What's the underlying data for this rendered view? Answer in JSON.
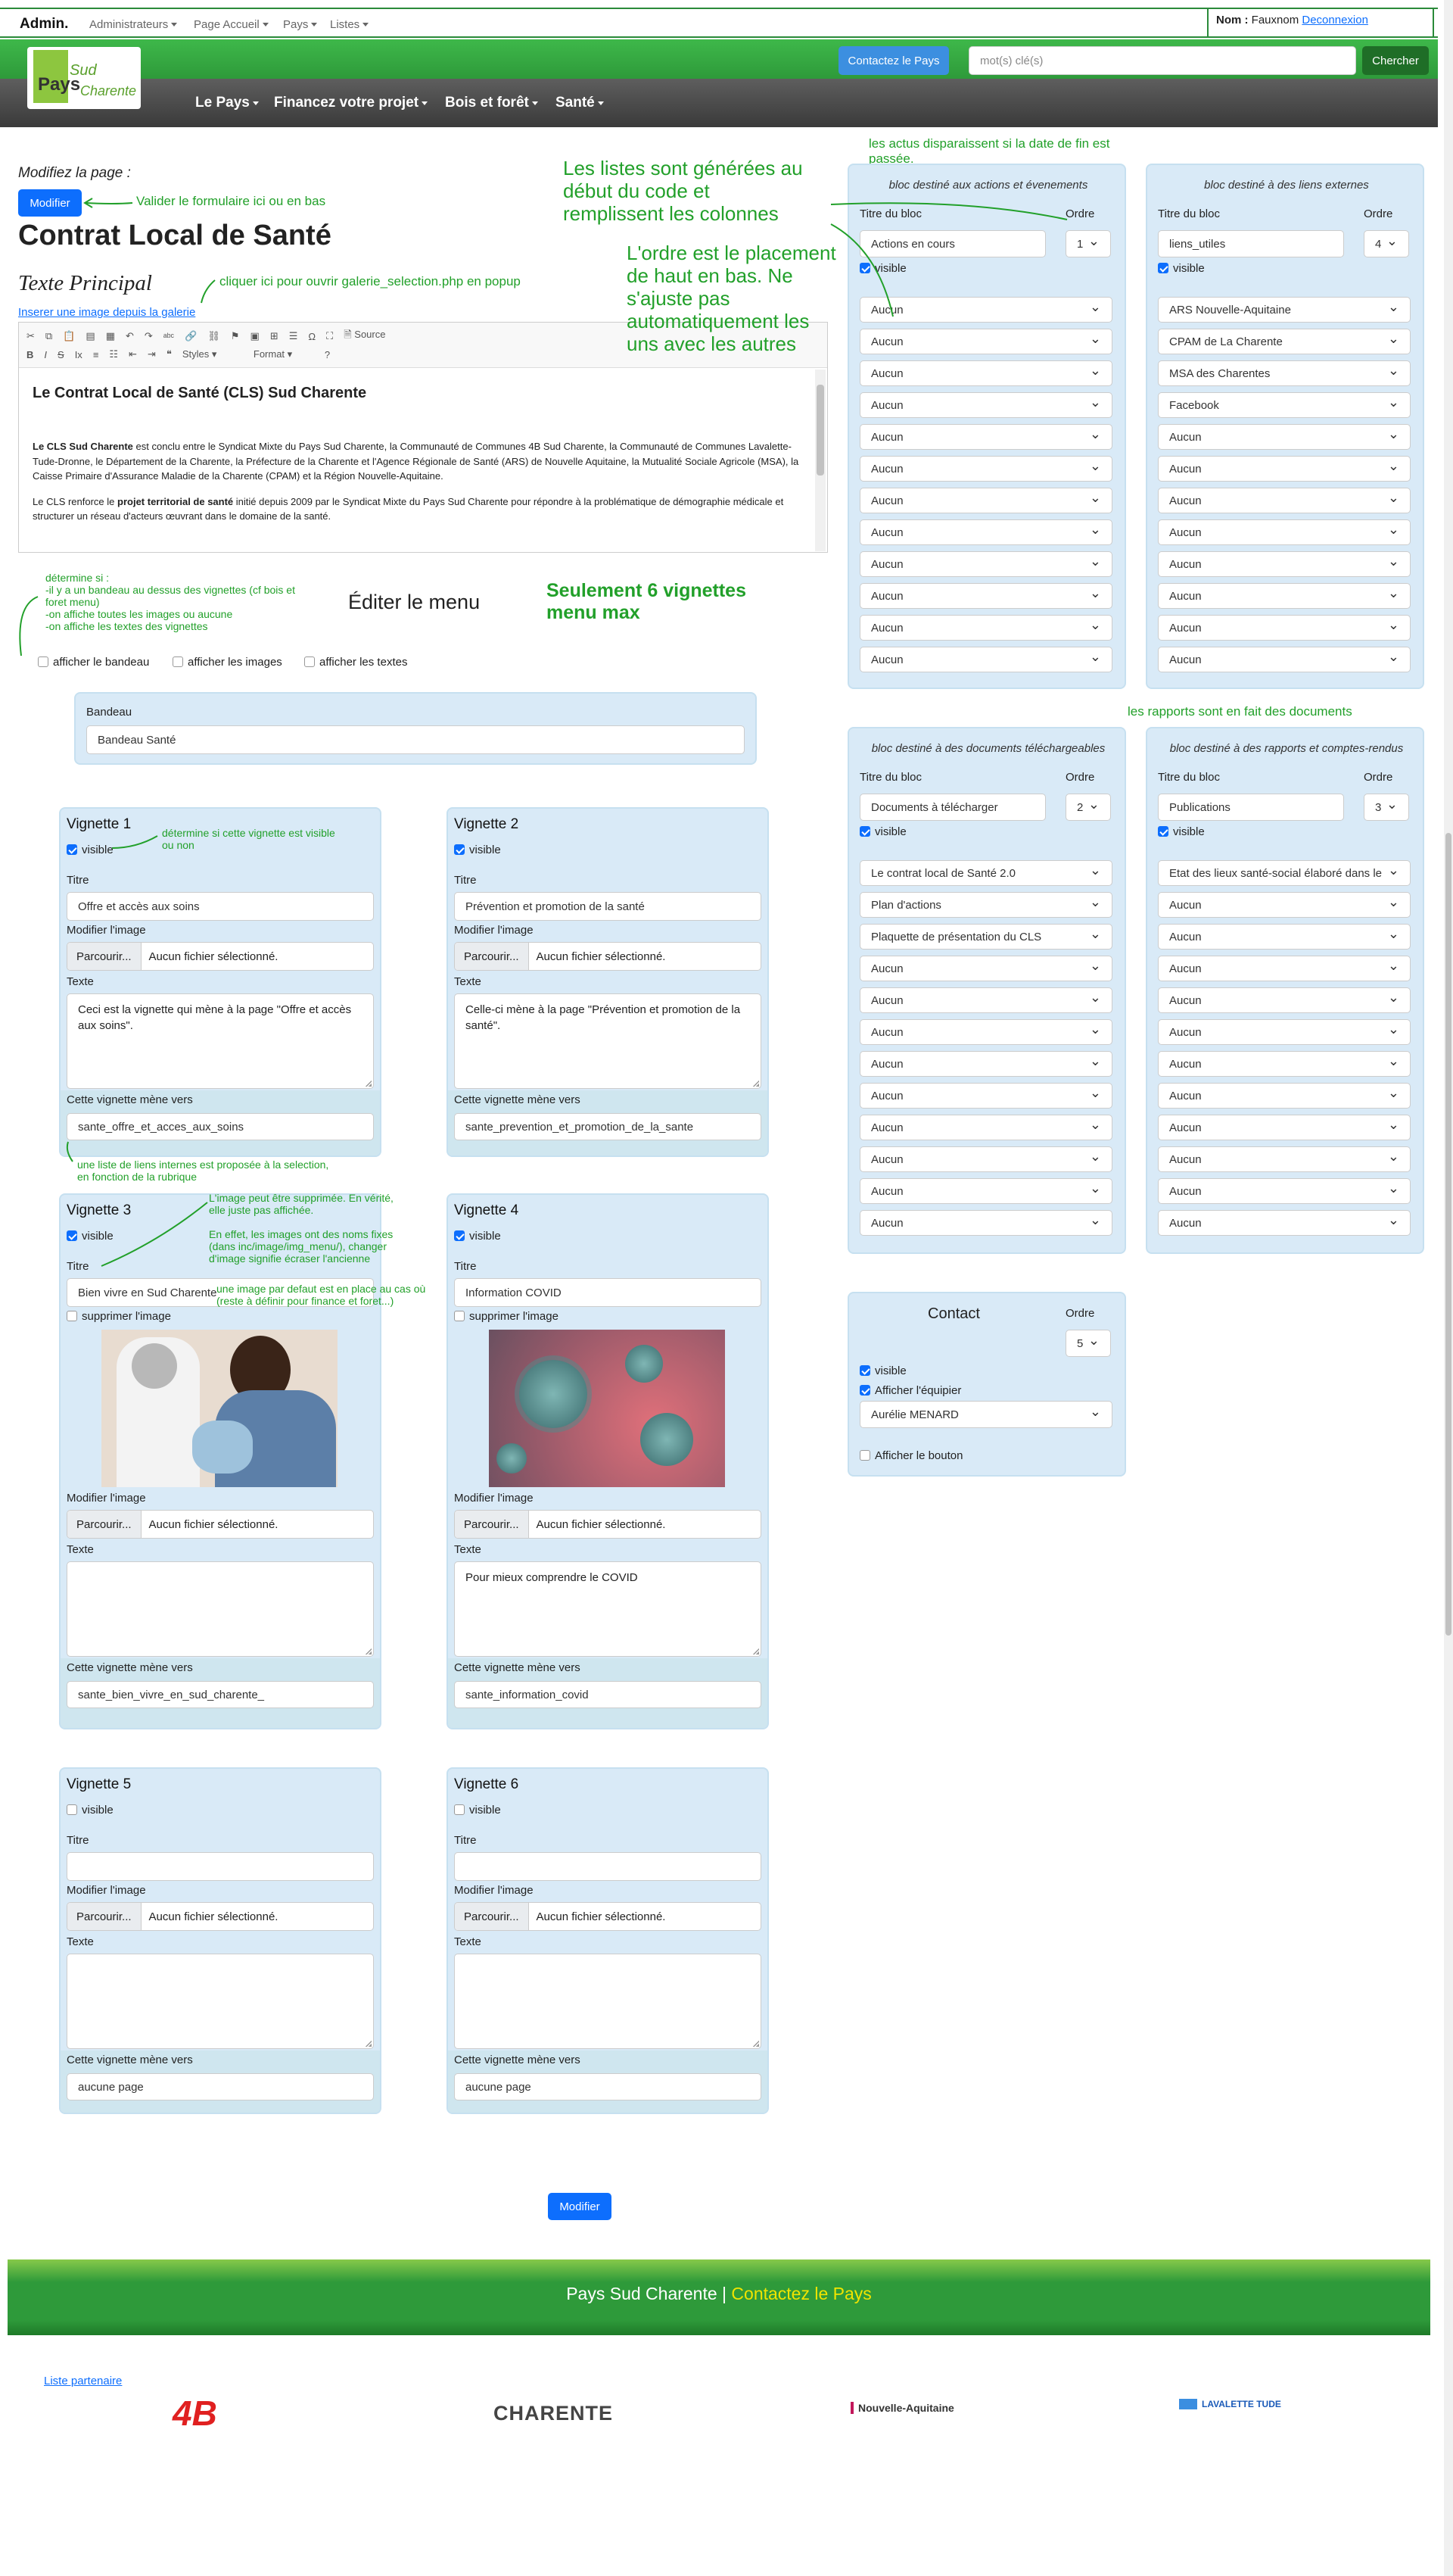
{
  "admin": {
    "brand": "Admin.",
    "menus": [
      "Administrateurs",
      "Page Accueil",
      "Pays",
      "Listes"
    ],
    "user_label": "Nom :",
    "user_name": " Fauxnom ",
    "logout": "Deconnexion"
  },
  "header": {
    "contact_button": "Contactez le Pays",
    "search_placeholder": "mot(s) clé(s)",
    "search_button": "Chercher",
    "logo_text_1": "Pays",
    "logo_text_2": "Sud",
    "logo_text_3": "Charente",
    "nav": [
      "Le Pays",
      "Financez votre projet",
      "Bois et forêt",
      "Santé"
    ]
  },
  "page": {
    "modify_label": "Modifiez la page :",
    "modify_button": "Modifier",
    "title": "Contrat Local de Santé",
    "main_text_label": "Texte Principal",
    "insert_image_link": "Inserer une image depuis la galerie",
    "toolbar_source": "Source",
    "toolbar_styles": "Styles",
    "toolbar_format": "Format",
    "editor_heading": "Le Contrat Local de Santé (CLS) Sud Charente",
    "editor_p1_bold": "Le CLS Sud Charente",
    "editor_p1": " est conclu entre le Syndicat Mixte du Pays Sud Charente, la Communauté de Communes 4B Sud Charente, la Communauté de Communes Lavalette-Tude-Dronne, le Département de la Charente, la Préfecture de la Charente et l'Agence Régionale de Santé (ARS) de Nouvelle Aquitaine, la Mutualité Sociale Agricole (MSA), la Caisse Primaire d'Assurance Maladie de la Charente (CPAM) et la Région Nouvelle-Aquitaine.",
    "editor_p2_a": "Le CLS renforce le ",
    "editor_p2_bold": "projet territorial de santé",
    "editor_p2": " initié depuis 2009 par le Syndicat Mixte du Pays Sud Charente pour répondre à la problématique de démographie médicale et structurer un réseau d'acteurs œuvrant dans le domaine de la santé.",
    "edit_menu_title": "Éditer le menu",
    "show_banner": "afficher le bandeau",
    "show_images": "afficher les images",
    "show_texts": "afficher les textes",
    "banner_label": "Bandeau",
    "banner_value": "Bandeau Santé",
    "bottom_button": "Modifier"
  },
  "annotations": {
    "validate": "Valider le formulaire ici ou en bas",
    "gallery": "cliquer ici pour ouvrir galerie_selection.php en popup",
    "lists": "Les listes sont générées au début du code et remplissent les colonnes",
    "order": "L'ordre est le placement de haut en bas. Ne s'ajuste pas automatiquement les uns avec les autres",
    "news": "les actus disparaissent si la date de fin est passée.",
    "reports": "les rapports sont en fait des documents",
    "banner_note": "détermine si :\n-il y a un bandeau au dessus des vignettes (cf bois et foret menu)\n-on affiche toutes les images ou aucune\n-on affiche les textes des vignettes",
    "max6": "Seulement 6 vignettes menu max",
    "visible_note": "détermine si cette vignette est visible ou non",
    "links_note": "une liste de liens internes est proposée à la selection, en fonction de la rubrique",
    "delete_note": "L'image peut être supprimée. En vérité, elle juste pas affichée.",
    "names_note": "En effet, les images ont des noms fixes (dans inc/image/img_menu/), changer d'image signifie écraser l'ancienne",
    "default_note": "une image par defaut est en place au cas où (reste à définir pour finance et foret...)"
  },
  "blocks": [
    {
      "title": "bloc destiné aux actions et évenements",
      "title_label": "Titre du bloc",
      "order_label": "Ordre",
      "title_value": "Actions en cours",
      "order": "1",
      "visible": "visible",
      "items": [
        "Aucun",
        "Aucun",
        "Aucun",
        "Aucun",
        "Aucun",
        "Aucun",
        "Aucun",
        "Aucun",
        "Aucun",
        "Aucun",
        "Aucun",
        "Aucun"
      ]
    },
    {
      "title": "bloc destiné à des liens externes",
      "title_label": "Titre du bloc",
      "order_label": "Ordre",
      "title_value": "liens_utiles",
      "order": "4",
      "visible": "visible",
      "items": [
        "ARS Nouvelle-Aquitaine",
        "CPAM de La Charente",
        "MSA des Charentes",
        "Facebook",
        "Aucun",
        "Aucun",
        "Aucun",
        "Aucun",
        "Aucun",
        "Aucun",
        "Aucun",
        "Aucun"
      ]
    },
    {
      "title": "bloc destiné à des documents téléchargeables",
      "title_label": "Titre du bloc",
      "order_label": "Ordre",
      "title_value": "Documents à télécharger",
      "order": "2",
      "visible": "visible",
      "items": [
        "Le contrat local de Santé 2.0",
        "Plan d'actions",
        "Plaquette de présentation du CLS",
        "Aucun",
        "Aucun",
        "Aucun",
        "Aucun",
        "Aucun",
        "Aucun",
        "Aucun",
        "Aucun",
        "Aucun"
      ]
    },
    {
      "title": "bloc destiné à des rapports et comptes-rendus",
      "title_label": "Titre du bloc",
      "order_label": "Ordre",
      "title_value": "Publications",
      "order": "3",
      "visible": "visible",
      "items": [
        "Etat des lieux santé-social élaboré dans le",
        "Aucun",
        "Aucun",
        "Aucun",
        "Aucun",
        "Aucun",
        "Aucun",
        "Aucun",
        "Aucun",
        "Aucun",
        "Aucun",
        "Aucun"
      ]
    }
  ],
  "contact": {
    "title": "Contact",
    "order_label": "Ordre",
    "order": "5",
    "visible": "visible",
    "show_team": "Afficher l'équipier",
    "member": "Aurélie MENARD",
    "show_button": "Afficher le bouton"
  },
  "vignettes": [
    {
      "title": "Vignette 1",
      "visible": "visible",
      "title_label": "Titre",
      "title_value": "Offre et accès aux soins",
      "image_label": "Modifier l'image",
      "browse": "Parcourir...",
      "no_file": "Aucun fichier sélectionné.",
      "text_label": "Texte",
      "text_value": "Ceci est la vignette qui mène à la page \"Offre et accès aux soins\".",
      "link_label": "Cette vignette mène vers",
      "link_value": "sante_offre_et_acces_aux_soins"
    },
    {
      "title": "Vignette 2",
      "visible": "visible",
      "title_label": "Titre",
      "title_value": "Prévention et promotion de la santé",
      "image_label": "Modifier l'image",
      "browse": "Parcourir...",
      "no_file": "Aucun fichier sélectionné.",
      "text_label": "Texte",
      "text_value": "Celle-ci mène à la page \"Prévention et promotion de la santé\".",
      "link_label": "Cette vignette mène vers",
      "link_value": "sante_prevention_et_promotion_de_la_sante"
    },
    {
      "title": "Vignette 3",
      "visible": "visible",
      "title_label": "Titre",
      "title_value": "Bien vivre en Sud Charente",
      "delete_image": "supprimer l'image",
      "image_label": "Modifier l'image",
      "browse": "Parcourir...",
      "no_file": "Aucun fichier sélectionné.",
      "text_label": "Texte",
      "text_value": "",
      "link_label": "Cette vignette mène vers",
      "link_value": "sante_bien_vivre_en_sud_charente_"
    },
    {
      "title": "Vignette 4",
      "visible": "visible",
      "title_label": "Titre",
      "title_value": "Information COVID",
      "delete_image": "supprimer l'image",
      "image_label": "Modifier l'image",
      "browse": "Parcourir...",
      "no_file": "Aucun fichier sélectionné.",
      "text_label": "Texte",
      "text_value": "Pour mieux comprendre le COVID",
      "link_label": "Cette vignette mène vers",
      "link_value": "sante_information_covid"
    },
    {
      "title": "Vignette 5",
      "visible": "visible",
      "title_label": "Titre",
      "title_value": "",
      "image_label": "Modifier l'image",
      "browse": "Parcourir...",
      "no_file": "Aucun fichier sélectionné.",
      "text_label": "Texte",
      "text_value": "",
      "link_label": "Cette vignette mène vers",
      "link_value": "aucune page"
    },
    {
      "title": "Vignette 6",
      "visible": "visible",
      "title_label": "Titre",
      "title_value": "",
      "image_label": "Modifier l'image",
      "browse": "Parcourir...",
      "no_file": "Aucun fichier sélectionné.",
      "text_label": "Texte",
      "text_value": "",
      "link_label": "Cette vignette mène vers",
      "link_value": "aucune page"
    }
  ],
  "footer": {
    "site": "Pays Sud Charente | ",
    "contact": "Contactez le Pays",
    "partners_link": "Liste partenaire",
    "logos": [
      "4B",
      "CHARENTE",
      "Nouvelle-Aquitaine",
      "LAVALETTE TUDE"
    ]
  },
  "colors": {
    "green": "#2e9a3a",
    "annotation": "#22a02a",
    "blue": "#0d6efd",
    "panel": "#d9eaf7",
    "footer_link": "#f0e400"
  }
}
